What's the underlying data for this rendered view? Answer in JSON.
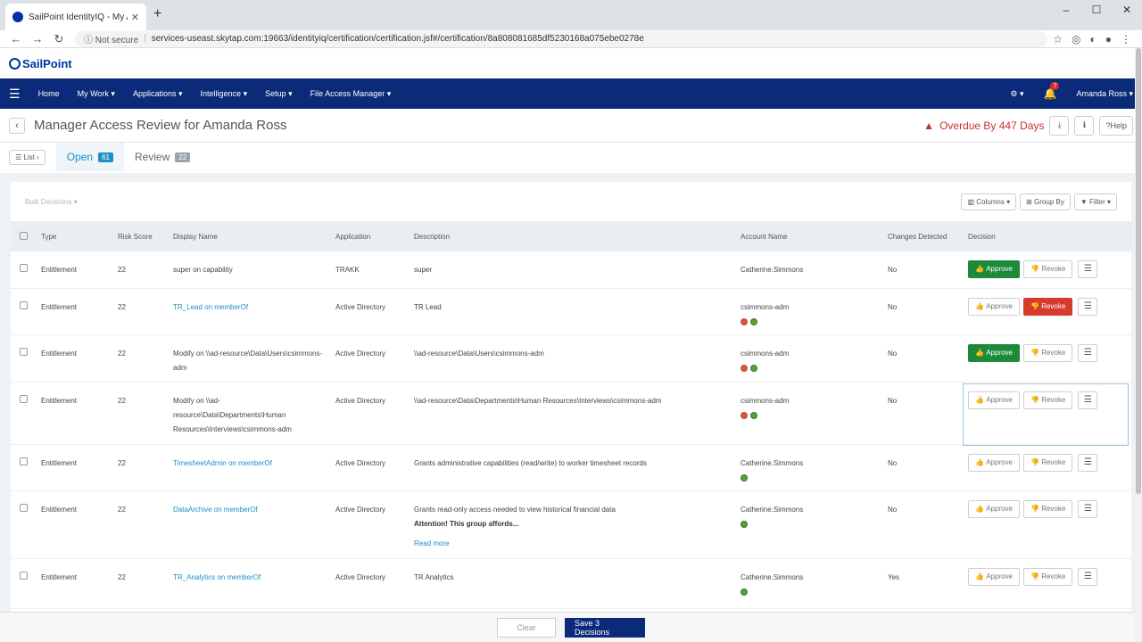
{
  "browser": {
    "tab_title": "SailPoint IdentityIQ - My Access",
    "security": "Not secure",
    "url": "services-useast.skytap.com:19663/identityiq/certification/certification.jsf#/certification/8a808081685df5230168a075ebe0278e"
  },
  "brand": "SailPoint",
  "nav": {
    "items": [
      "Home",
      "My Work",
      "Applications",
      "Intelligence",
      "Setup",
      "File Access Manager"
    ],
    "notif_count": "7",
    "user": "Amanda Ross"
  },
  "header": {
    "title": "Manager Access Review for Amanda Ross",
    "overdue": "Overdue By 447 Days",
    "help": "Help"
  },
  "tabs": {
    "list": "List",
    "open_label": "Open",
    "open_count": "61",
    "review_label": "Review",
    "review_count": "22"
  },
  "toolbar": {
    "bulk": "Bulk Decisions",
    "columns": "Columns",
    "group_by": "Group By",
    "filter": "Filter"
  },
  "table": {
    "headers": [
      "Type",
      "Risk Score",
      "Display Name",
      "Application",
      "Description",
      "Account Name",
      "Changes Detected",
      "Decision"
    ],
    "approve_label": "Approve",
    "revoke_label": "Revoke",
    "rows": [
      {
        "type": "Entitlement",
        "risk": "22",
        "name": "super on capability",
        "name_link": false,
        "app": "TRAKK",
        "desc": "super",
        "account": "Catherine.Simmons",
        "changes": "No",
        "decision": "approve"
      },
      {
        "type": "Entitlement",
        "risk": "22",
        "name": "TR_Lead on memberOf",
        "name_link": true,
        "app": "Active Directory",
        "desc": "TR Lead",
        "account": "csimmons-adm",
        "changes": "No",
        "decision": "revoke"
      },
      {
        "type": "Entitlement",
        "risk": "22",
        "name": "Modify on \\\\ad-resource\\Data\\Users\\csimmons-adm",
        "name_link": false,
        "app": "Active Directory",
        "desc": "\\\\ad-resource\\Data\\Users\\csimmons-adm",
        "account": "csimmons-adm",
        "changes": "No",
        "decision": "approve"
      },
      {
        "type": "Entitlement",
        "risk": "22",
        "name": "Modify on \\\\ad-resource\\Data\\Departments\\Human Resources\\Interviews\\csimmons-adm",
        "name_link": false,
        "app": "Active Directory",
        "desc": "\\\\ad-resource\\Data\\Departments\\Human Resources\\Interviews\\csimmons-adm",
        "account": "csimmons-adm",
        "changes": "No",
        "decision": "none"
      },
      {
        "type": "Entitlement",
        "risk": "22",
        "name": "TimesheetAdmin on memberOf",
        "name_link": true,
        "app": "Active Directory",
        "desc": "Grants administrative capabilities (read/write) to worker timesheet records",
        "account": "Catherine.Simmons",
        "changes": "No",
        "decision": "none"
      },
      {
        "type": "Entitlement",
        "risk": "22",
        "name": "DataArchive on memberOf",
        "name_link": true,
        "app": "Active Directory",
        "desc": "Grants read-only access needed to view historical financial data",
        "desc_bold": "Attention! This group affords...",
        "read_more": "Read more",
        "account": "Catherine.Simmons",
        "changes": "No",
        "decision": "none"
      },
      {
        "type": "Entitlement",
        "risk": "22",
        "name": "TR_Analytics on memberOf",
        "name_link": true,
        "app": "Active Directory",
        "desc": "TR Analytics",
        "account": "Catherine.Simmons",
        "changes": "Yes",
        "decision": "none"
      }
    ]
  },
  "footer": {
    "clear": "Clear",
    "save": "Save 3 Decisions"
  }
}
